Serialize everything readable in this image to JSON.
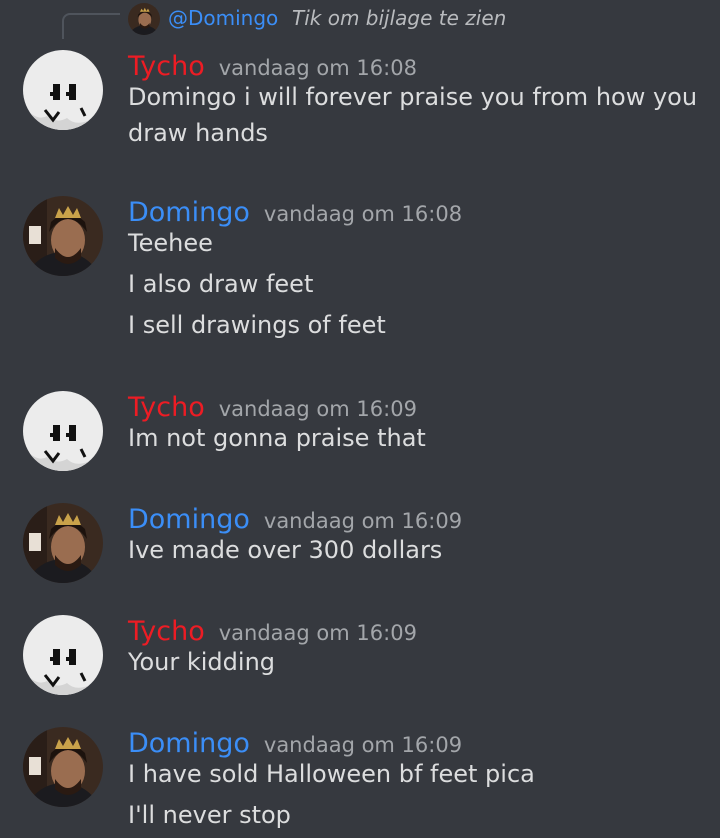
{
  "reply": {
    "author": "@Domingo",
    "text": "Tik om bijlage te zien"
  },
  "messages": [
    {
      "author": "Tycho",
      "author_color": "#ed1c24",
      "avatar": "white-ghost-face-avatar",
      "time": "vandaag om 16:08",
      "lines": [
        "Domingo i will forever praise you from how you draw hands"
      ]
    },
    {
      "author": "Domingo",
      "author_color": "#3b8ef7",
      "avatar": "photo-avatar",
      "time": "vandaag om 16:08",
      "lines": [
        "Teehee",
        "I also draw feet",
        "I sell drawings of feet"
      ]
    },
    {
      "author": "Tycho",
      "author_color": "#ed1c24",
      "avatar": "white-ghost-face-avatar",
      "time": "vandaag om 16:09",
      "lines": [
        "Im not gonna praise that"
      ]
    },
    {
      "author": "Domingo",
      "author_color": "#3b8ef7",
      "avatar": "photo-avatar",
      "time": "vandaag om 16:09",
      "lines": [
        "Ive made over 300 dollars"
      ]
    },
    {
      "author": "Tycho",
      "author_color": "#ed1c24",
      "avatar": "white-ghost-face-avatar",
      "time": "vandaag om 16:09",
      "lines": [
        "Your kidding"
      ]
    },
    {
      "author": "Domingo",
      "author_color": "#3b8ef7",
      "avatar": "photo-avatar",
      "time": "vandaag om 16:09",
      "lines": [
        "I have sold Halloween bf feet pica",
        "I'll never stop"
      ]
    }
  ],
  "colors": {
    "background": "#36393f",
    "message_text": "#dcddde",
    "timestamp": "#a3a6aa"
  }
}
